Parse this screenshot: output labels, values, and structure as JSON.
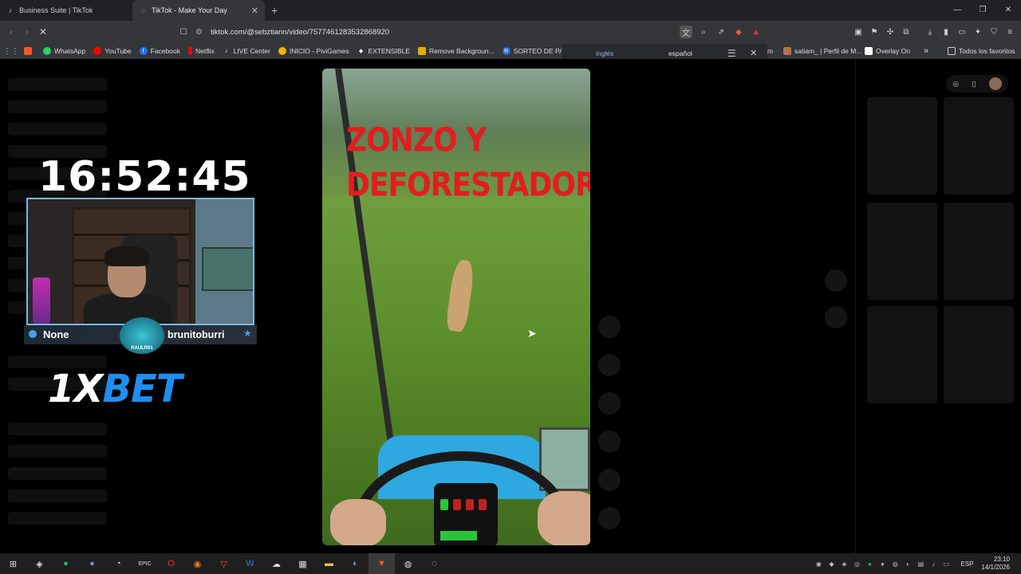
{
  "browser": {
    "tabs": [
      {
        "label": "Business Suite | TikTok",
        "icon": "tiktok-icon"
      },
      {
        "label": "TikTok - Make Your Day",
        "icon": "tiktok-icon"
      }
    ],
    "url": "tiktok.com/@sebztiann/video/7577461283532868920",
    "window_controls": [
      "—",
      "❐",
      "✕"
    ]
  },
  "bookmarks": [
    {
      "label": "WhatsApp",
      "icon": "whatsapp-icon",
      "color": "#25d366"
    },
    {
      "label": "YouTube",
      "icon": "youtube-icon",
      "color": "#ff0000"
    },
    {
      "label": "Facebook",
      "icon": "facebook-icon",
      "color": "#1877f2"
    },
    {
      "label": "Netflix",
      "icon": "netflix-icon",
      "color": "#e50914"
    },
    {
      "label": "LIVE Center",
      "icon": "tiktok-icon",
      "color": "#111111"
    },
    {
      "label": "INICIO - PiviGames",
      "icon": "pivigames-icon",
      "color": "#f0b400"
    },
    {
      "label": "EXTENSIBLE",
      "icon": "diamond-icon",
      "color": "#555555"
    },
    {
      "label": "Remove Backgroun...",
      "icon": "image-icon",
      "color": "#e0b000"
    },
    {
      "label": "SORTEO DE PASE D...",
      "icon": "r-icon",
      "color": "#2d6bd8"
    }
  ],
  "bookmarks_right": [
    {
      "label": "m",
      "icon": "generic-icon"
    },
    {
      "label": "satiam_ | Perfil de M...",
      "icon": "profile-icon"
    },
    {
      "label": "Overlay On",
      "icon": "page-icon"
    },
    {
      "label": "»",
      "icon": "chevron-icon"
    },
    {
      "label": "Todos los favoritos",
      "icon": "folder-icon"
    }
  ],
  "translate": {
    "option_source": "inglés",
    "option_target": "español"
  },
  "overlay": {
    "clock": "16:52:45",
    "status": "None",
    "username": "brunitoburri",
    "badge_text": "RAULR91",
    "sponsor_a": "1X",
    "sponsor_b": "BET"
  },
  "video": {
    "caption_line1": "ZONZO   Y",
    "caption_line2": "DEFORESTADOR"
  },
  "taskbar": {
    "language": "ESP",
    "time": "23:10",
    "date": "14/1/2026"
  }
}
